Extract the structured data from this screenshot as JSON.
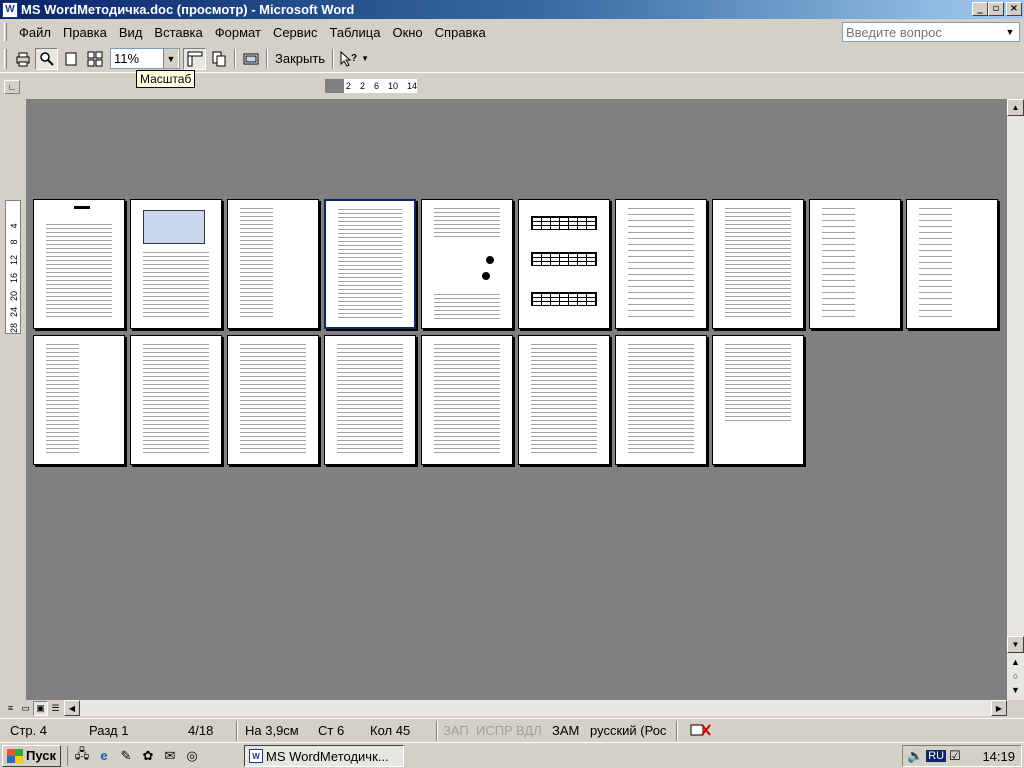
{
  "window": {
    "title": "MS WordМетодичка.doc (просмотр) - Microsoft Word",
    "icon": "word-icon",
    "controls": {
      "minimize": "_",
      "maximize": "▫",
      "close": "×"
    }
  },
  "menu": {
    "items": [
      {
        "label": "Файл"
      },
      {
        "label": "Правка"
      },
      {
        "label": "Вид"
      },
      {
        "label": "Вставка"
      },
      {
        "label": "Формат"
      },
      {
        "label": "Сервис"
      },
      {
        "label": "Таблица"
      },
      {
        "label": "Окно"
      },
      {
        "label": "Справка"
      }
    ],
    "help_placeholder": "Введите вопрос"
  },
  "toolbar": {
    "zoom_value": "11%",
    "close_label": "Закрыть",
    "tooltip": "Масштаб"
  },
  "ruler": {
    "h_ticks": [
      "2",
      "2",
      "6",
      "10",
      "14"
    ],
    "v_ticks": [
      "4",
      "8",
      "12",
      "16",
      "20",
      "24",
      "28"
    ]
  },
  "document": {
    "pages_total": 18,
    "current_page": 4
  },
  "status": {
    "page": "Стр. 4",
    "section": "Разд 1",
    "page_of": "4/18",
    "at": "На 3,9см",
    "line": "Ст 6",
    "column": "Кол 45",
    "rec": "ЗАП",
    "trk": "ИСПР",
    "ext": "ВДЛ",
    "ovr": "ЗАМ",
    "language": "русский (Рос"
  },
  "taskbar": {
    "start_label": "Пуск",
    "task_label": "MS WordМетодичк...",
    "tray_lang": "RU",
    "clock": "14:19"
  }
}
